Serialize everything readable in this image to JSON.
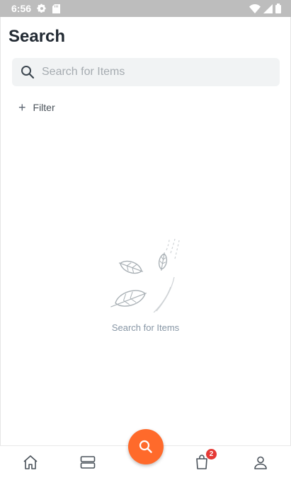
{
  "status_bar": {
    "time": "6:56",
    "icons": [
      "settings-icon",
      "sd-card-icon",
      "wifi-icon",
      "signal-icon",
      "battery-icon"
    ]
  },
  "header": {
    "title": "Search"
  },
  "search": {
    "placeholder": "Search for Items",
    "value": "",
    "icon": "search-icon"
  },
  "filter": {
    "label": "Filter",
    "icon": "plus-icon"
  },
  "empty_state": {
    "text": "Search for Items",
    "illustration": "falling-leaves-illustration"
  },
  "bottom_nav": {
    "items": [
      {
        "icon": "home-icon"
      },
      {
        "icon": "browse-icon"
      },
      {
        "icon": "cart-icon",
        "badge": "2"
      },
      {
        "icon": "account-icon"
      }
    ],
    "fab": {
      "icon": "search-icon"
    }
  },
  "colors": {
    "accent": "#ff6a2b",
    "status_bar": "#bdbdbd",
    "badge": "#e53935",
    "search_bg": "#f1f3f4"
  }
}
